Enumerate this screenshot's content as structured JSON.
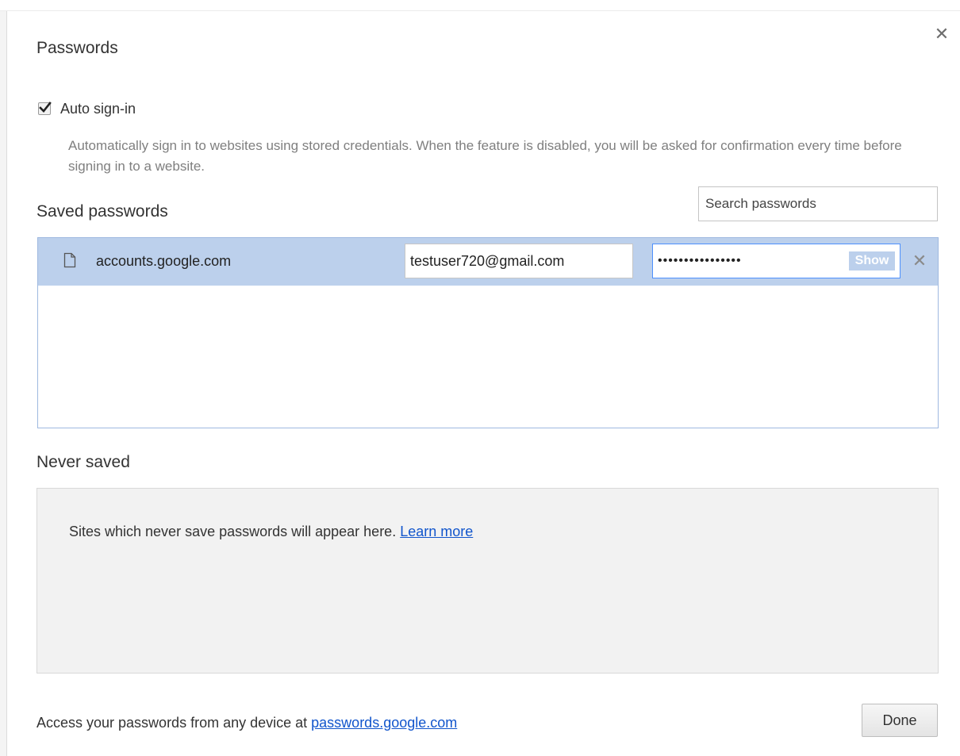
{
  "dialog": {
    "title": "Passwords",
    "close_icon": "close-icon"
  },
  "auto_signin": {
    "checked": true,
    "label": "Auto sign-in",
    "description": "Automatically sign in to websites using stored credentials. When the feature is disabled, you will be asked for confirmation every time before signing in to a website."
  },
  "saved_passwords": {
    "title": "Saved passwords",
    "search_placeholder": "Search passwords",
    "rows": [
      {
        "icon": "file-icon",
        "site": "accounts.google.com",
        "username": "testuser720@gmail.com",
        "password_masked": "••••••••••••••••",
        "show_label": "Show",
        "remove_icon": "remove-icon",
        "selected": true
      }
    ]
  },
  "never_saved": {
    "title": "Never saved",
    "empty_text": "Sites which never save passwords will appear here.",
    "learn_more": "Learn more"
  },
  "footer": {
    "text": "Access your passwords from any device at",
    "link": "passwords.google.com",
    "done_label": "Done"
  },
  "colors": {
    "selected_row": "#bcd0ec",
    "focus_border": "#4d90fe",
    "link": "#1155cc",
    "secondary_text": "#7f7f7f",
    "never_saved_bg": "#f2f2f2"
  }
}
